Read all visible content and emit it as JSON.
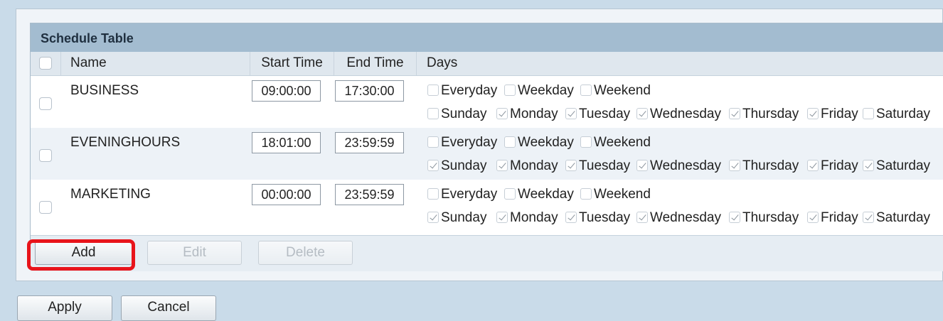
{
  "table": {
    "title": "Schedule Table",
    "columns": {
      "name": "Name",
      "start": "Start Time",
      "end": "End Time",
      "days": "Days"
    },
    "rows": [
      {
        "name": "BUSINESS",
        "start": "09:00:00",
        "end": "17:30:00",
        "everyday": "Everyday",
        "weekday": "Weekday",
        "weekend": "Weekend",
        "days": [
          {
            "label": "Sunday",
            "checked": false
          },
          {
            "label": "Monday",
            "checked": true
          },
          {
            "label": "Tuesday",
            "checked": true
          },
          {
            "label": "Wednesday",
            "checked": true
          },
          {
            "label": "Thursday",
            "checked": true
          },
          {
            "label": "Friday",
            "checked": true
          },
          {
            "label": "Saturday",
            "checked": false
          }
        ]
      },
      {
        "name": "EVENINGHOURS",
        "start": "18:01:00",
        "end": "23:59:59",
        "everyday": "Everyday",
        "weekday": "Weekday",
        "weekend": "Weekend",
        "days": [
          {
            "label": "Sunday",
            "checked": true
          },
          {
            "label": "Monday",
            "checked": true
          },
          {
            "label": "Tuesday",
            "checked": true
          },
          {
            "label": "Wednesday",
            "checked": true
          },
          {
            "label": "Thursday",
            "checked": true
          },
          {
            "label": "Friday",
            "checked": true
          },
          {
            "label": "Saturday",
            "checked": true
          }
        ]
      },
      {
        "name": "MARKETING",
        "start": "00:00:00",
        "end": "23:59:59",
        "everyday": "Everyday",
        "weekday": "Weekday",
        "weekend": "Weekend",
        "days": [
          {
            "label": "Sunday",
            "checked": true
          },
          {
            "label": "Monday",
            "checked": true
          },
          {
            "label": "Tuesday",
            "checked": true
          },
          {
            "label": "Wednesday",
            "checked": true
          },
          {
            "label": "Thursday",
            "checked": true
          },
          {
            "label": "Friday",
            "checked": true
          },
          {
            "label": "Saturday",
            "checked": true
          }
        ]
      }
    ]
  },
  "table_actions": {
    "add": "Add",
    "edit": "Edit",
    "delete": "Delete"
  },
  "form_actions": {
    "apply": "Apply",
    "cancel": "Cancel"
  },
  "colors": {
    "highlight": "#e8141b",
    "title_bar": "#a3bcd0",
    "page_bg": "#c9dbe9"
  }
}
